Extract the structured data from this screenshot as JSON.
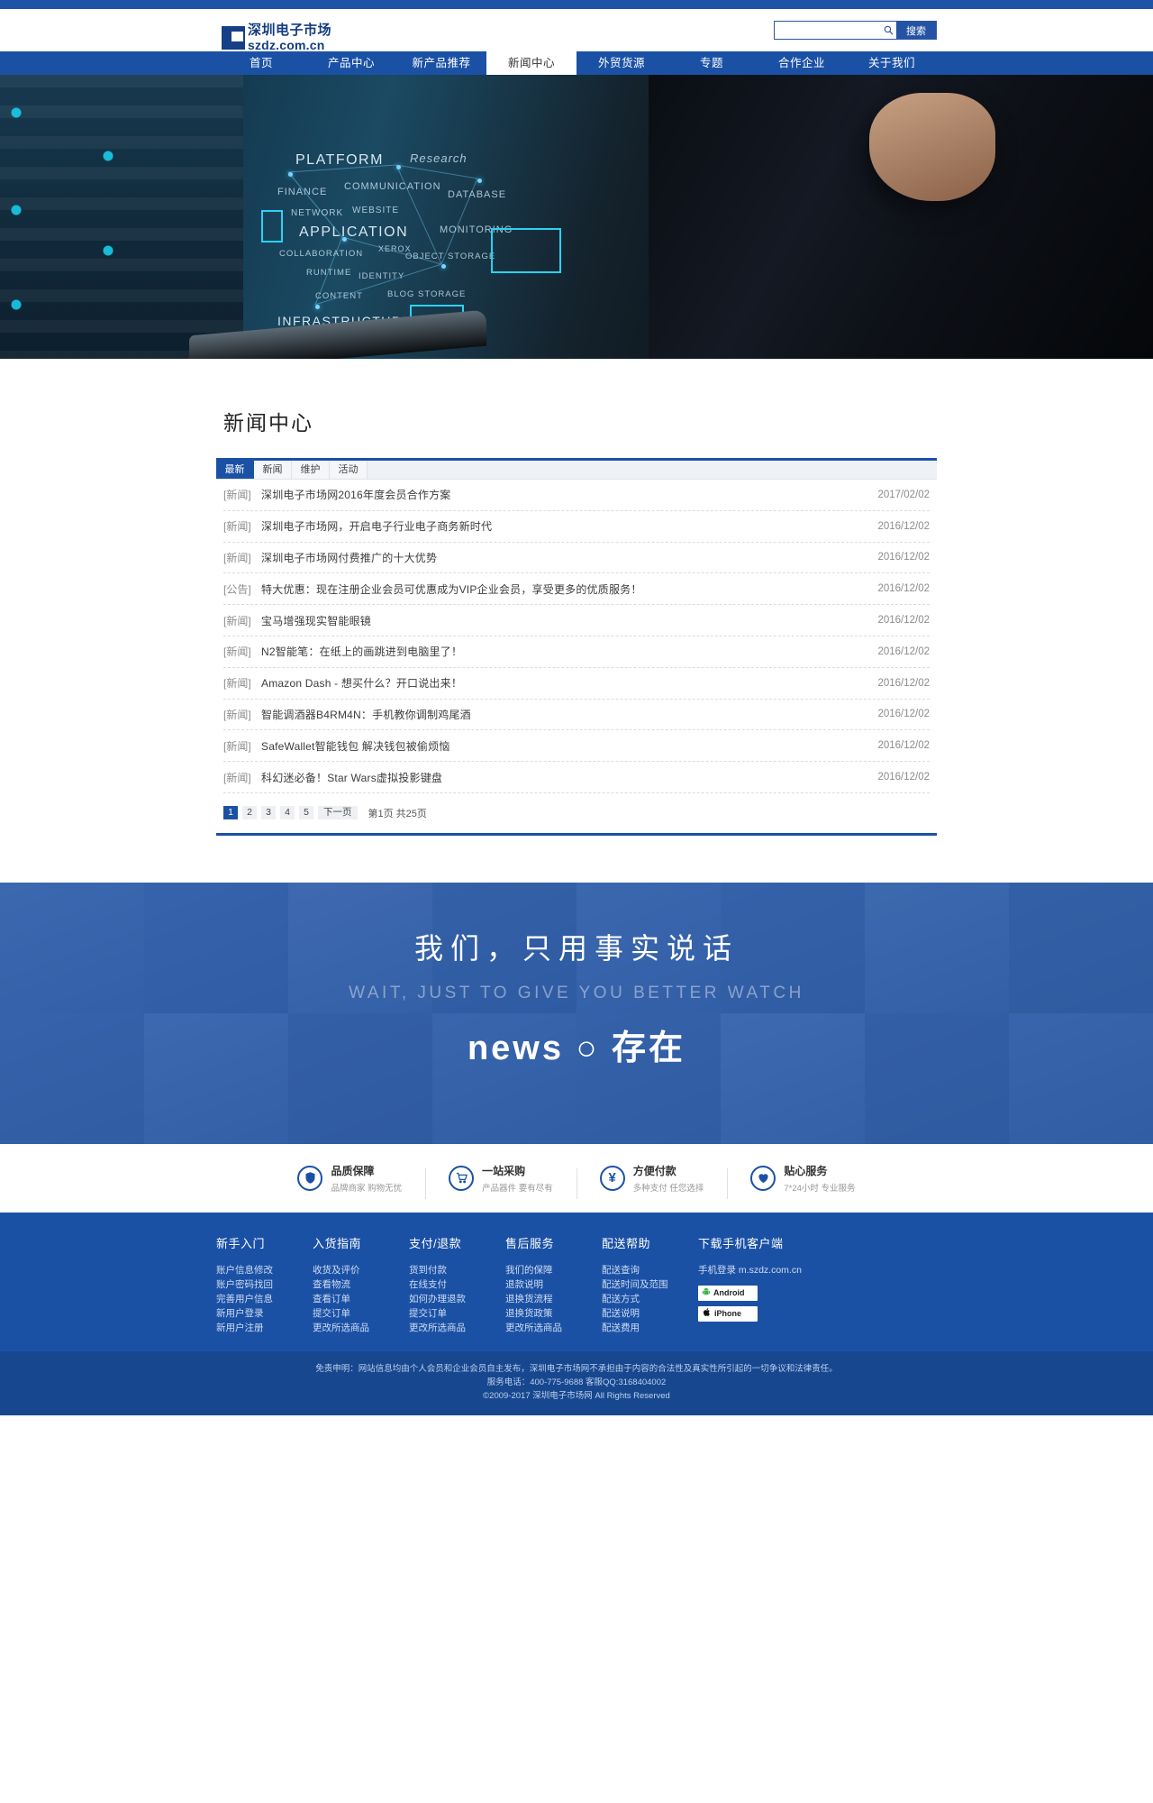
{
  "header": {
    "logo_cn": "深圳电子市场",
    "logo_en": "szdz.com.cn",
    "search": {
      "value": "",
      "placeholder": "",
      "button_label": "搜索",
      "icon": "search-icon"
    }
  },
  "nav": {
    "items": [
      {
        "label": "首页",
        "active": false
      },
      {
        "label": "产品中心",
        "active": false
      },
      {
        "label": "新产品推荐",
        "active": false
      },
      {
        "label": "新闻中心",
        "active": true
      },
      {
        "label": "外贸货源",
        "active": false
      },
      {
        "label": "专题",
        "active": false
      },
      {
        "label": "合作企业",
        "active": false
      },
      {
        "label": "关于我们",
        "active": false
      }
    ]
  },
  "banner": {
    "words": [
      "PLATFORM",
      "Research",
      "FINANCE",
      "COMMUNICATION",
      "DATABASE",
      "NETWORK",
      "WEBSITE",
      "APPLICATION",
      "MONITORING",
      "COLLABORATION",
      "XEROX",
      "OBJECT STORAGE",
      "RUNTIME",
      "IDENTITY",
      "CONTENT",
      "BLOG STORAGE",
      "INFRASTRUCTURE"
    ]
  },
  "main": {
    "title": "新闻中心",
    "tabs": [
      {
        "label": "最新",
        "active": true
      },
      {
        "label": "新闻",
        "active": false
      },
      {
        "label": "维护",
        "active": false
      },
      {
        "label": "活动",
        "active": false
      }
    ],
    "news": [
      {
        "category": "[新闻]",
        "title": "深圳电子市场网2016年度会员合作方案",
        "date": "2017/02/02"
      },
      {
        "category": "[新闻]",
        "title": "深圳电子市场网，开启电子行业电子商务新时代",
        "date": "2016/12/02"
      },
      {
        "category": "[新闻]",
        "title": "深圳电子市场网付费推广的十大优势",
        "date": "2016/12/02"
      },
      {
        "category": "[公告]",
        "title": "特大优惠：现在注册企业会员可优惠成为VIP企业会员，享受更多的优质服务！",
        "date": "2016/12/02"
      },
      {
        "category": "[新闻]",
        "title": "宝马增强现实智能眼镜",
        "date": "2016/12/02"
      },
      {
        "category": "[新闻]",
        "title": "N2智能笔：在纸上的画跳进到电脑里了！",
        "date": "2016/12/02"
      },
      {
        "category": "[新闻]",
        "title": "Amazon Dash - 想买什么？开口说出来！",
        "date": "2016/12/02"
      },
      {
        "category": "[新闻]",
        "title": "智能调酒器B4RM4N：手机教你调制鸡尾酒",
        "date": "2016/12/02"
      },
      {
        "category": "[新闻]",
        "title": "SafeWallet智能钱包 解决钱包被偷烦恼",
        "date": "2016/12/02"
      },
      {
        "category": "[新闻]",
        "title": "科幻迷必备！Star Wars虚拟投影键盘",
        "date": "2016/12/02"
      }
    ],
    "pagination": {
      "pages": [
        "1",
        "2",
        "3",
        "4",
        "5"
      ],
      "current": "1",
      "next_label": "下一页",
      "info": "第1页 共25页"
    }
  },
  "slogan": {
    "line1": "我们，只用事实说话",
    "line2": "WAIT, JUST TO GIVE YOU BETTER WATCH",
    "line3": "news ○ 存在"
  },
  "services": [
    {
      "icon": "shield-icon",
      "glyph": "🛡",
      "title": "品质保障",
      "subtitle": "品牌商家 购物无忧"
    },
    {
      "icon": "cart-icon",
      "glyph": "🛒",
      "title": "一站采购",
      "subtitle": "产品器件 要有尽有"
    },
    {
      "icon": "yuan-icon",
      "glyph": "¥",
      "title": "方便付款",
      "subtitle": "多种支付 任您选择"
    },
    {
      "icon": "heart-icon",
      "glyph": "♥",
      "title": "贴心服务",
      "subtitle": "7*24小时 专业服务"
    }
  ],
  "footer": {
    "columns": [
      {
        "heading": "新手入门",
        "links": [
          "账户信息修改",
          "账户密码找回",
          "完善用户信息",
          "新用户登录",
          "新用户注册"
        ]
      },
      {
        "heading": "入货指南",
        "links": [
          "收货及评价",
          "查看物流",
          "查看订单",
          "提交订单",
          "更改所选商品"
        ]
      },
      {
        "heading": "支付/退款",
        "links": [
          "货到付款",
          "在线支付",
          "如何办理退款",
          "提交订单",
          "更改所选商品"
        ]
      },
      {
        "heading": "售后服务",
        "links": [
          "我们的保障",
          "退款说明",
          "退换货流程",
          "退换货政策",
          "更改所选商品"
        ]
      },
      {
        "heading": "配送帮助",
        "links": [
          "配送查询",
          "配送时间及范围",
          "配送方式",
          "配送说明",
          "配送费用"
        ]
      }
    ],
    "app": {
      "heading": "下载手机客户端",
      "mobile_login": "手机登录  m.szdz.com.cn",
      "buttons": [
        {
          "icon": "android-icon",
          "label": "Android"
        },
        {
          "icon": "apple-icon",
          "label": "iPhone"
        }
      ]
    }
  },
  "bottom": {
    "disclaimer": "免责申明：网站信息均由个人会员和企业会员自主发布，深圳电子市场网不承担由于内容的合法性及真实性所引起的一切争议和法律责任。",
    "contact": "服务电话：400-775-9688  客服QQ:3168404002",
    "copyright": "©2009-2017  深圳电子市场网 All Rights Reserved"
  }
}
